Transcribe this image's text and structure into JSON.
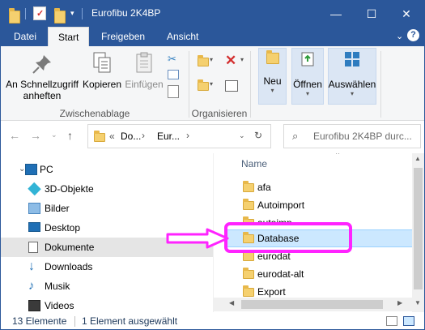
{
  "window": {
    "title": "Eurofibu 2K4BP",
    "minimize_glyph": "—",
    "maximize_glyph": "☐",
    "close_glyph": "✕"
  },
  "ribbon_tabs": [
    "Datei",
    "Start",
    "Freigeben",
    "Ansicht"
  ],
  "ribbon": {
    "pin_label_1": "An Schnellzugriff",
    "pin_label_2": "anheften",
    "copy_label": "Kopieren",
    "paste_label": "Einfügen",
    "group_clipboard": "Zwischenablage",
    "group_organize": "Organisieren",
    "new_label": "Neu",
    "open_label": "Öffnen",
    "select_label": "Auswählen"
  },
  "address": {
    "breadcrumb_prefix": "«",
    "crumb_1": "Do...",
    "crumb_2": "Eur...",
    "search_placeholder": "Eurofibu 2K4BP durc..."
  },
  "nav_items": [
    {
      "label": "PC",
      "icon": "pc-icon"
    },
    {
      "label": "3D-Objekte",
      "icon": "3d-objects-icon"
    },
    {
      "label": "Bilder",
      "icon": "pictures-icon"
    },
    {
      "label": "Desktop",
      "icon": "desktop-icon"
    },
    {
      "label": "Dokumente",
      "icon": "documents-icon"
    },
    {
      "label": "Downloads",
      "icon": "downloads-icon"
    },
    {
      "label": "Musik",
      "icon": "music-icon"
    },
    {
      "label": "Videos",
      "icon": "videos-icon"
    }
  ],
  "file_list": {
    "column_header": "Name",
    "items": [
      "afa",
      "Autoimport",
      "autoimp",
      "Database",
      "eurodat",
      "eurodat-alt",
      "Export"
    ]
  },
  "status": {
    "count": "13 Elemente",
    "selection": "1 Element ausgewählt"
  },
  "colors": {
    "title_bar": "#2b579a",
    "selection": "#cce8ff",
    "annotation": "#ff23ff"
  }
}
